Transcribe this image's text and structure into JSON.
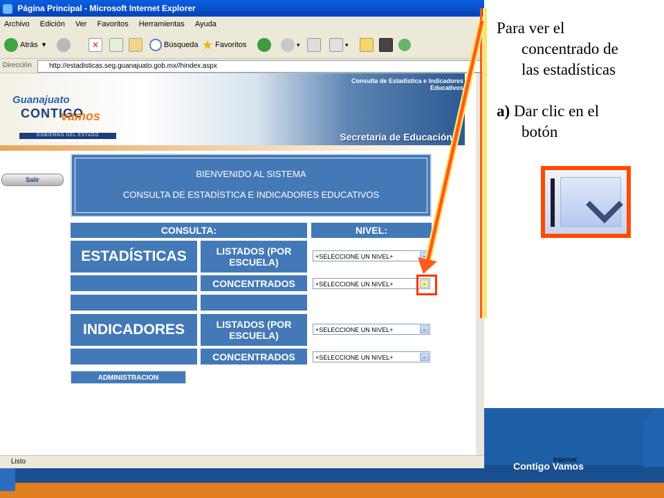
{
  "window": {
    "title": "Página Principal - Microsoft Internet Explorer"
  },
  "menu": [
    "Archivo",
    "Edición",
    "Ver",
    "Favoritos",
    "Herramientas",
    "Ayuda"
  ],
  "toolbar": {
    "back_label": "Atrás",
    "search_label": "Búsqueda",
    "favorites_label": "Favoritos"
  },
  "address": {
    "label": "Dirección",
    "url": "http://estadisticas.seg.guanajuato.gob.mx//hindex.aspx"
  },
  "banner": {
    "logo_top": "Guanajuato",
    "logo_main": "CONTIGO",
    "logo_script": "vamos",
    "logo_gov": "GOBIERNO DEL ESTADO",
    "consulta_line1": "Consulta de Estadística e Indicadores",
    "consulta_line2": "Educativos",
    "secretaria": "Secretaría de Educación"
  },
  "salir_label": "Salir",
  "welcome": {
    "line1": "BIENVENIDO AL SISTEMA",
    "line2": "CONSULTA DE ESTADÍSTICA E INDICADORES EDUCATIVOS"
  },
  "table": {
    "consulta_header": "CONSULTA:",
    "nivel_header": "NIVEL:",
    "estadisticas": "ESTADÍSTICAS",
    "indicadores": "INDICADORES",
    "listados": "LISTADOS (POR ESCUELA)",
    "concentrados": "CONCENTRADOS",
    "select_placeholder": "+SELECCIONE UN NIVEL+"
  },
  "admin_label": "ADMINISTRACION",
  "status": {
    "left": "Listo",
    "zone": "Internet"
  },
  "callout": {
    "line1": "Para ver el",
    "line2": "concentrado de",
    "line3": "las estadísticas",
    "step_letter": "a)",
    "step_text": "Dar clic en el",
    "step_text2": "botón"
  },
  "slide_brand": "Contigo Vamos",
  "colors": {
    "accent": "#4479b7",
    "highlight": "#ff3300",
    "callout_border": "#f9e86a"
  }
}
